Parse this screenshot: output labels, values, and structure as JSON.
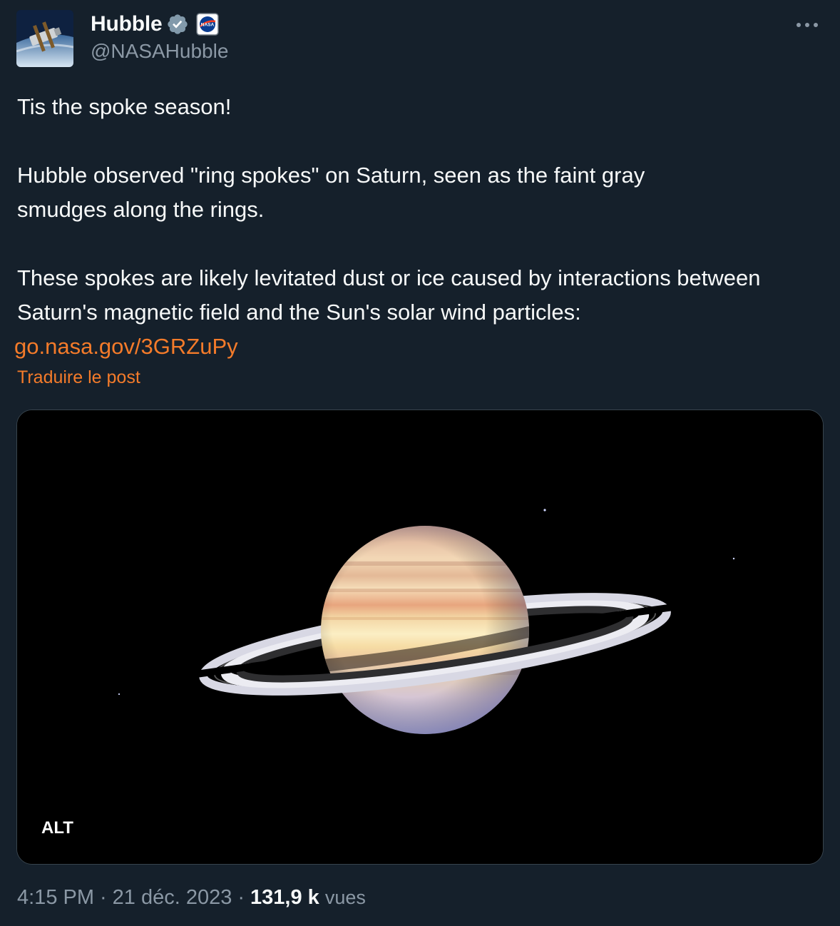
{
  "author": {
    "display_name": "Hubble",
    "handle": "@NASAHubble",
    "verified_badge_icon": "verified-badge-icon",
    "affiliate_icon": "nasa-logo-icon",
    "avatar_icon": "hubble-telescope-avatar"
  },
  "more_icon": "more-horizontal-icon",
  "tweet": {
    "line1": "Tis the spoke season!",
    "para2": "Hubble observed \"ring spokes\" on Saturn, seen as the faint gray smudges along the rings.",
    "para3": "These spokes are likely levitated dust or ice caused by interactions between Saturn's magnetic field and the Sun's solar wind particles:",
    "link": "go.nasa.gov/3GRZuPy"
  },
  "translate_label": "Traduire le post",
  "media": {
    "alt_label": "ALT",
    "image": "saturn-rings-image"
  },
  "meta": {
    "time": "4:15 PM",
    "separator1": "·",
    "date": "21 déc. 2023",
    "separator2": "·",
    "views_count": "131,9 k",
    "views_label": "vues"
  },
  "colors": {
    "background": "#15202b",
    "accent_link": "#f47b2a",
    "secondary_text": "#8b98a5",
    "primary_text": "#f7f9f9",
    "verified_badge": "#829aab"
  }
}
